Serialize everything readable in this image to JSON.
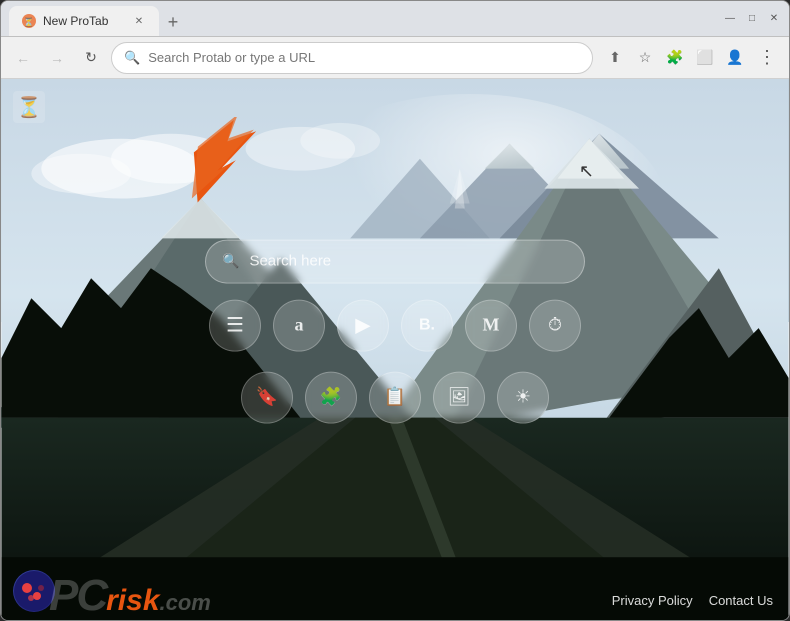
{
  "browser": {
    "tab_title": "New ProTab",
    "new_tab_label": "+",
    "address_placeholder": "Search Protab or type a URL"
  },
  "nav": {
    "back_label": "←",
    "forward_label": "→",
    "refresh_label": "↻",
    "more_label": "⋮"
  },
  "page": {
    "search_placeholder": "Search here",
    "quick_icons_row1": [
      {
        "label": "≡",
        "name": "menu-icon"
      },
      {
        "label": "a",
        "name": "amazon-icon"
      },
      {
        "label": "▶",
        "name": "play-icon"
      },
      {
        "label": "B.",
        "name": "booking-icon"
      },
      {
        "label": "M",
        "name": "gmail-icon"
      },
      {
        "label": "◷",
        "name": "history-icon"
      }
    ],
    "quick_icons_row2": [
      {
        "label": "🔖",
        "name": "bookmark-icon"
      },
      {
        "label": "🧩",
        "name": "extensions-icon"
      },
      {
        "label": "📋",
        "name": "clipboard-icon"
      },
      {
        "label": "🖼",
        "name": "image-icon"
      },
      {
        "label": "☀",
        "name": "weather-icon"
      }
    ],
    "footer_links": [
      {
        "label": "Privacy Policy",
        "name": "privacy-policy-link"
      },
      {
        "label": "Contact Us",
        "name": "contact-us-link"
      }
    ],
    "logo_pc": "PC",
    "logo_risk": "risk",
    "logo_com": ".com"
  },
  "window_controls": {
    "minimize": "—",
    "maximize": "□",
    "close": "✕"
  }
}
